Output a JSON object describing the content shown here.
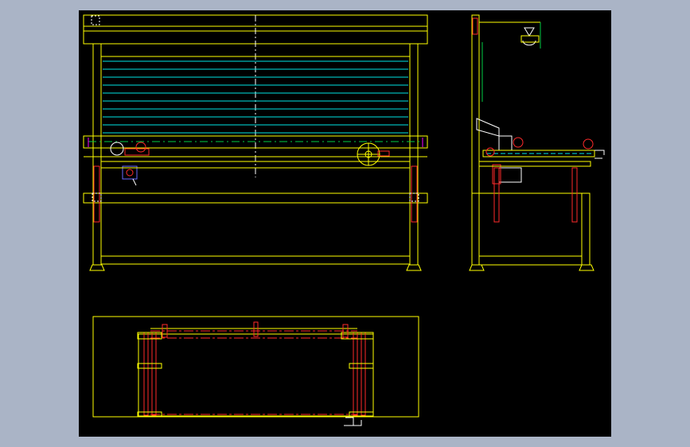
{
  "viewer": {
    "background": "#aab4c6",
    "sheet_background": "#000000"
  },
  "palette": {
    "frame": "#ffff00",
    "slat": "#00e5e5",
    "part": "#ff2a2a",
    "accent": "#ff00ff",
    "detail": "#ffffff",
    "motor": "#6a6aff",
    "fixture": "#00cc44"
  },
  "views": [
    {
      "name": "front-elevation-view"
    },
    {
      "name": "side-elevation-view"
    },
    {
      "name": "plan-view"
    }
  ]
}
